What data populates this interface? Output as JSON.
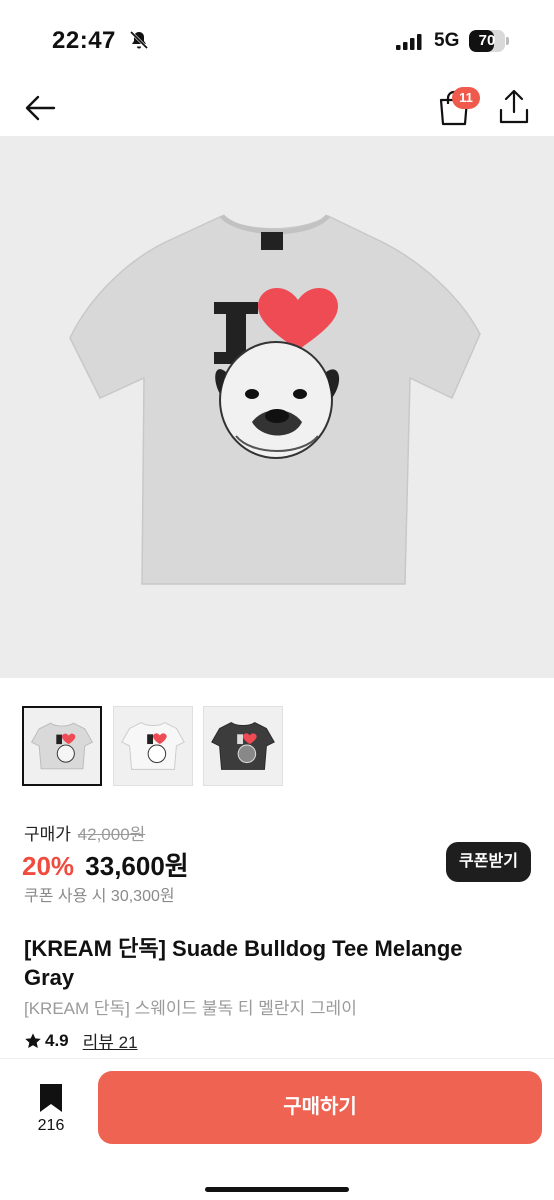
{
  "status_bar": {
    "time": "22:47",
    "network": "5G",
    "battery": "70",
    "battery_level": 0.7,
    "icons": [
      "bell-slash-icon",
      "signal-icon"
    ]
  },
  "header": {
    "icons": [
      "back-arrow-icon",
      "shopping-bag-icon",
      "share-icon"
    ],
    "cart_count": "11"
  },
  "product": {
    "image_alt": "gray t-shirt",
    "thumbnails": [
      "gray",
      "white",
      "charcoal"
    ],
    "thumb_colors": [
      "#d9d9d9",
      "#f7f7f7",
      "#3c3c3c"
    ],
    "selected_thumbnail": 0
  },
  "pricing": {
    "label": "구매가",
    "original_price": "42,000원",
    "discount": "20%",
    "sale_price": "33,600원",
    "coupon_price": "쿠폰 사용 시 30,300원",
    "coupon_button": "쿠폰받기"
  },
  "info": {
    "title": "[KREAM 단독] Suade Bulldog Tee Melange Gray",
    "subtitle": "[KREAM 단독] 스웨이드 불독 티 멜란지 그레이",
    "rating": "4.9",
    "reviews": "리뷰 21"
  },
  "bottom_bar": {
    "save_count": "216",
    "buy_label": "구매하기"
  },
  "colors": {
    "accent": "#ef6352",
    "discount": "#ef4b3e",
    "badge": "#ef5a4c"
  }
}
